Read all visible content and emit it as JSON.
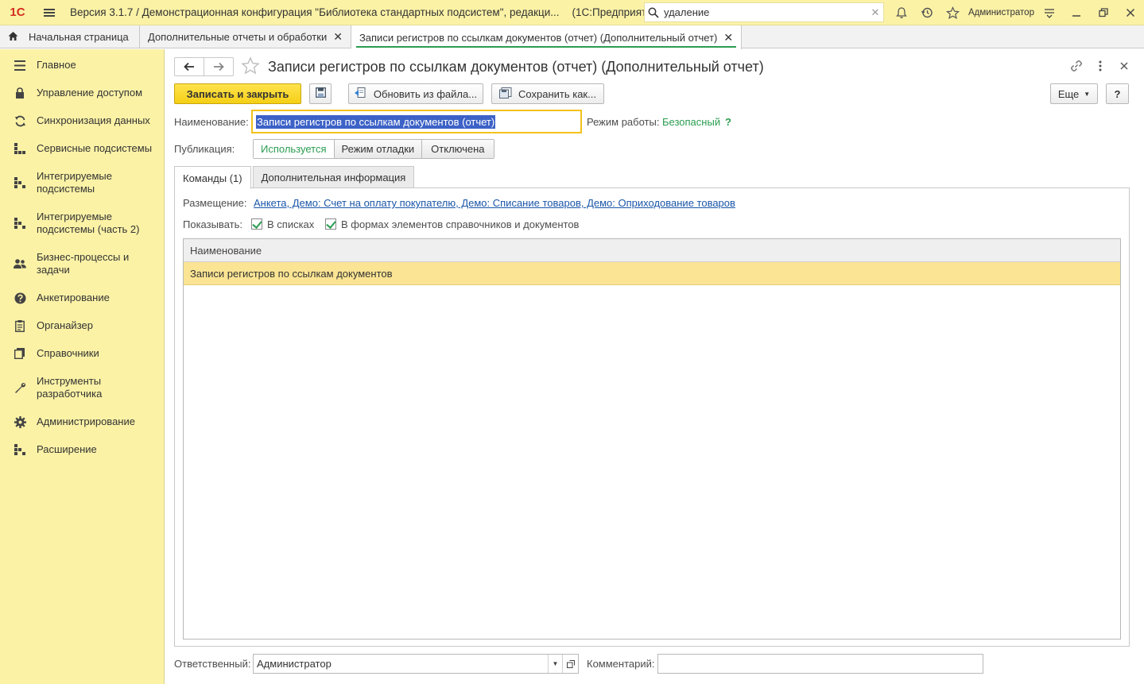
{
  "app": {
    "logo": "1С",
    "title": "Версия 3.1.7 / Демонстрационная конфигурация \"Библиотека стандартных подсистем\", редакци...",
    "suffix": "(1С:Предприятие)",
    "search_value": "удаление",
    "user": "Администратор"
  },
  "tabs": [
    {
      "label": "Начальная страница"
    },
    {
      "label": "Дополнительные отчеты и обработки"
    },
    {
      "label": "Записи регистров по ссылкам документов (отчет) (Дополнительный отчет)"
    }
  ],
  "sidebar": {
    "items": [
      {
        "label": "Главное",
        "icon": "menu-lines-icon"
      },
      {
        "label": "Управление доступом",
        "icon": "lock-icon"
      },
      {
        "label": "Синхронизация данных",
        "icon": "sync-icon"
      },
      {
        "label": "Сервисные подсистемы",
        "icon": "nodes-icon"
      },
      {
        "label": "Интегрируемые подсистемы",
        "icon": "blocks-icon"
      },
      {
        "label": "Интегрируемые подсистемы (часть 2)",
        "icon": "blocks-icon"
      },
      {
        "label": "Бизнес-процессы и задачи",
        "icon": "users-icon"
      },
      {
        "label": "Анкетирование",
        "icon": "question-circle-icon"
      },
      {
        "label": "Органайзер",
        "icon": "notepad-icon"
      },
      {
        "label": "Справочники",
        "icon": "books-icon"
      },
      {
        "label": "Инструменты разработчика",
        "icon": "wrench-icon"
      },
      {
        "label": "Администрирование",
        "icon": "gear-icon"
      },
      {
        "label": "Расширение",
        "icon": "blocks-icon"
      }
    ]
  },
  "form": {
    "title": "Записи регистров по ссылкам документов (отчет) (Дополнительный отчет)",
    "buttons": {
      "save_close": "Записать и закрыть",
      "update_from_file": "Обновить из файла...",
      "save_as": "Сохранить как...",
      "more": "Еще",
      "help": "?"
    },
    "name_label": "Наименование:",
    "name_value": "Записи регистров по ссылкам документов (отчет)",
    "mode_label": "Режим работы:",
    "mode_value": "Безопасный",
    "mode_help": "?",
    "publication_label": "Публикация:",
    "publication_options": [
      "Используется",
      "Режим отладки",
      "Отключена"
    ],
    "publication_selected": "Используется",
    "page_tabs": [
      "Команды (1)",
      "Дополнительная информация"
    ],
    "placement_label": "Размещение:",
    "placement_value": "Анкета, Демо: Счет на оплату покупателю, Демо: Списание товаров, Демо: Оприходование товаров",
    "show_label": "Показывать:",
    "show_in_lists": "В списках",
    "show_in_forms": "В формах элементов справочников и документов",
    "show_in_lists_checked": true,
    "show_in_forms_checked": true,
    "table": {
      "columns": [
        "Наименование"
      ],
      "rows": [
        "Записи регистров по ссылкам документов"
      ]
    },
    "responsible_label": "Ответственный:",
    "responsible_value": "Администратор",
    "comment_label": "Комментарий:",
    "comment_value": ""
  },
  "colors": {
    "panel_yellow": "#fbf2a6",
    "primary_button": "#f5cf16",
    "accent_green": "#2a9d51",
    "selected_row": "#fbe493",
    "link_blue": "#1a56a8"
  }
}
